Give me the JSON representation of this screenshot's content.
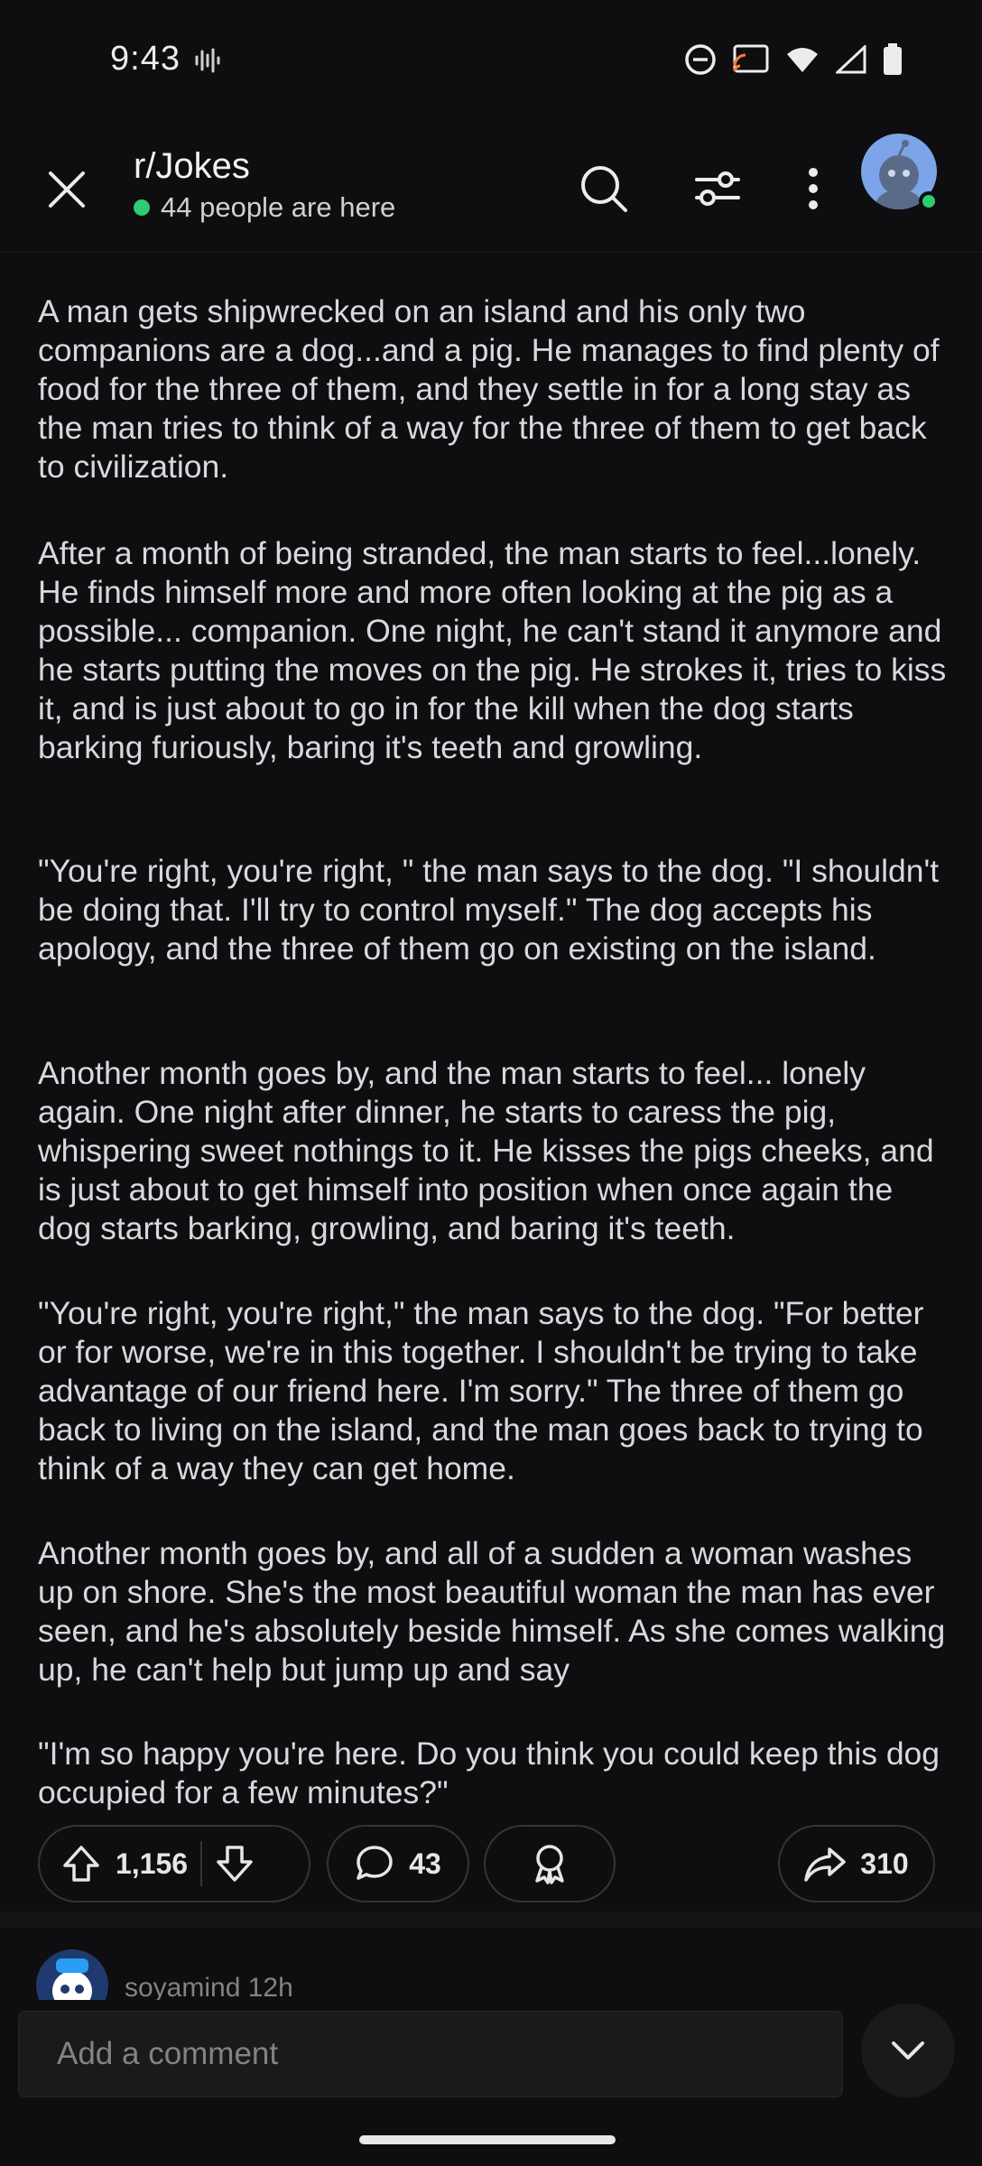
{
  "status_bar": {
    "time": "9:43"
  },
  "header": {
    "subreddit": "r/Jokes",
    "online_text": "44 people are here"
  },
  "post": {
    "paragraphs": [
      "A man gets shipwrecked on an island and his only two companions are a dog...and a pig. He manages to find plenty of food for the three of them, and they settle in for a long stay as the man tries to think of a way for the three of them to get back to civilization.",
      "After a month of being stranded, the man starts to feel...lonely. He finds himself more and more often looking at the pig as a possible... companion. One night, he can't stand it anymore and he starts putting the moves on the pig. He strokes it, tries to kiss it, and is just about to go in for the kill when the dog starts barking furiously, baring it's teeth and growling.",
      "\"You're right, you're right, \" the man says to the dog. \"I shouldn't be doing that. I'll try to control myself.\" The dog accepts his apology, and the three of them go on existing on the island.",
      "Another month goes by, and the man starts to feel... lonely again. One night after dinner, he starts to caress the pig, whispering sweet nothings to it. He kisses the pigs cheeks, and is just about to get himself into position when once again the dog starts barking, growling, and baring it's teeth.",
      "\"You're right, you're right,\" the man says to the dog. \"For better or for worse, we're in this together. I shouldn't be trying to take advantage of our friend here. I'm sorry.\" The three of them go back to living on the island, and the man goes back to trying to think of a way they can get home.",
      "Another month goes by, and all of a sudden a woman washes up on shore. She's the most beautiful woman the man has ever seen, and he's absolutely beside himself. As she comes walking up, he can't help but jump up and say",
      "\"I'm so happy you're here. Do you think you could keep this dog occupied for a few minutes?\""
    ],
    "upvotes": "1,156",
    "comments": "43",
    "shares": "310"
  },
  "comment_peek": {
    "username": "soyamind",
    "age": "12h"
  },
  "composer": {
    "placeholder": "Add a comment"
  },
  "colors": {
    "background": "#0e0e10",
    "online_green": "#2ecc71",
    "text": "#d7dadc"
  }
}
